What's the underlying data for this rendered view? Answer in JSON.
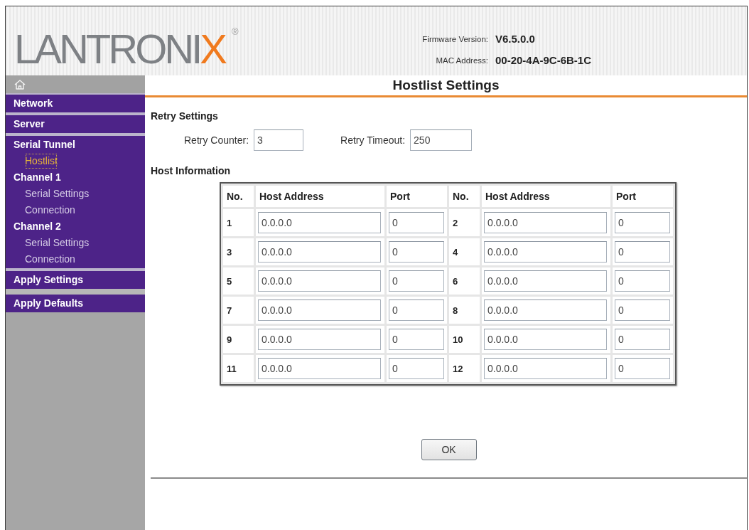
{
  "header": {
    "logo": {
      "text": "LANTRONI",
      "accent": "X",
      "mark": "®"
    },
    "info": [
      {
        "label": "Firmware Version:",
        "value": "V6.5.0.0"
      },
      {
        "label": "MAC Address:",
        "value": "00-20-4A-9C-6B-1C"
      }
    ]
  },
  "sidebar": {
    "menu": [
      {
        "items": [
          {
            "label": "Network",
            "selected": false
          }
        ]
      },
      {
        "items": [
          {
            "label": "Server",
            "selected": false
          }
        ]
      },
      {
        "items": [
          {
            "label": "Serial Tunnel",
            "selected": false,
            "children": [
              {
                "label": "Hostlist",
                "selected": true
              }
            ]
          },
          {
            "label": "Channel 1",
            "selected": false,
            "children": [
              {
                "label": "Serial Settings",
                "selected": false
              },
              {
                "label": "Connection",
                "selected": false
              }
            ]
          },
          {
            "label": "Channel 2",
            "selected": false,
            "children": [
              {
                "label": "Serial Settings",
                "selected": false
              },
              {
                "label": "Connection",
                "selected": false
              }
            ]
          }
        ]
      }
    ],
    "actions": [
      {
        "label": "Apply Settings"
      },
      {
        "label": "Apply Defaults"
      }
    ]
  },
  "page_title": "Hostlist Settings",
  "retry_settings": {
    "heading": "Retry Settings",
    "fields": [
      {
        "label": "Retry Counter:",
        "value": "3"
      },
      {
        "label": "Retry Timeout:",
        "value": "250"
      }
    ]
  },
  "host_information": {
    "heading": "Host Information",
    "columns": [
      "No.",
      "Host Address",
      "Port",
      "No.",
      "Host Address",
      "Port"
    ],
    "rows": [
      [
        {
          "no": "1",
          "address": "0.0.0.0",
          "port": "0"
        },
        {
          "no": "2",
          "address": "0.0.0.0",
          "port": "0"
        }
      ],
      [
        {
          "no": "3",
          "address": "0.0.0.0",
          "port": "0"
        },
        {
          "no": "4",
          "address": "0.0.0.0",
          "port": "0"
        }
      ],
      [
        {
          "no": "5",
          "address": "0.0.0.0",
          "port": "0"
        },
        {
          "no": "6",
          "address": "0.0.0.0",
          "port": "0"
        }
      ],
      [
        {
          "no": "7",
          "address": "0.0.0.0",
          "port": "0"
        },
        {
          "no": "8",
          "address": "0.0.0.0",
          "port": "0"
        }
      ],
      [
        {
          "no": "9",
          "address": "0.0.0.0",
          "port": "0"
        },
        {
          "no": "10",
          "address": "0.0.0.0",
          "port": "0"
        }
      ],
      [
        {
          "no": "11",
          "address": "0.0.0.0",
          "port": "0"
        },
        {
          "no": "12",
          "address": "0.0.0.0",
          "port": "0"
        }
      ]
    ]
  },
  "buttons": [
    {
      "label": "OK"
    }
  ]
}
